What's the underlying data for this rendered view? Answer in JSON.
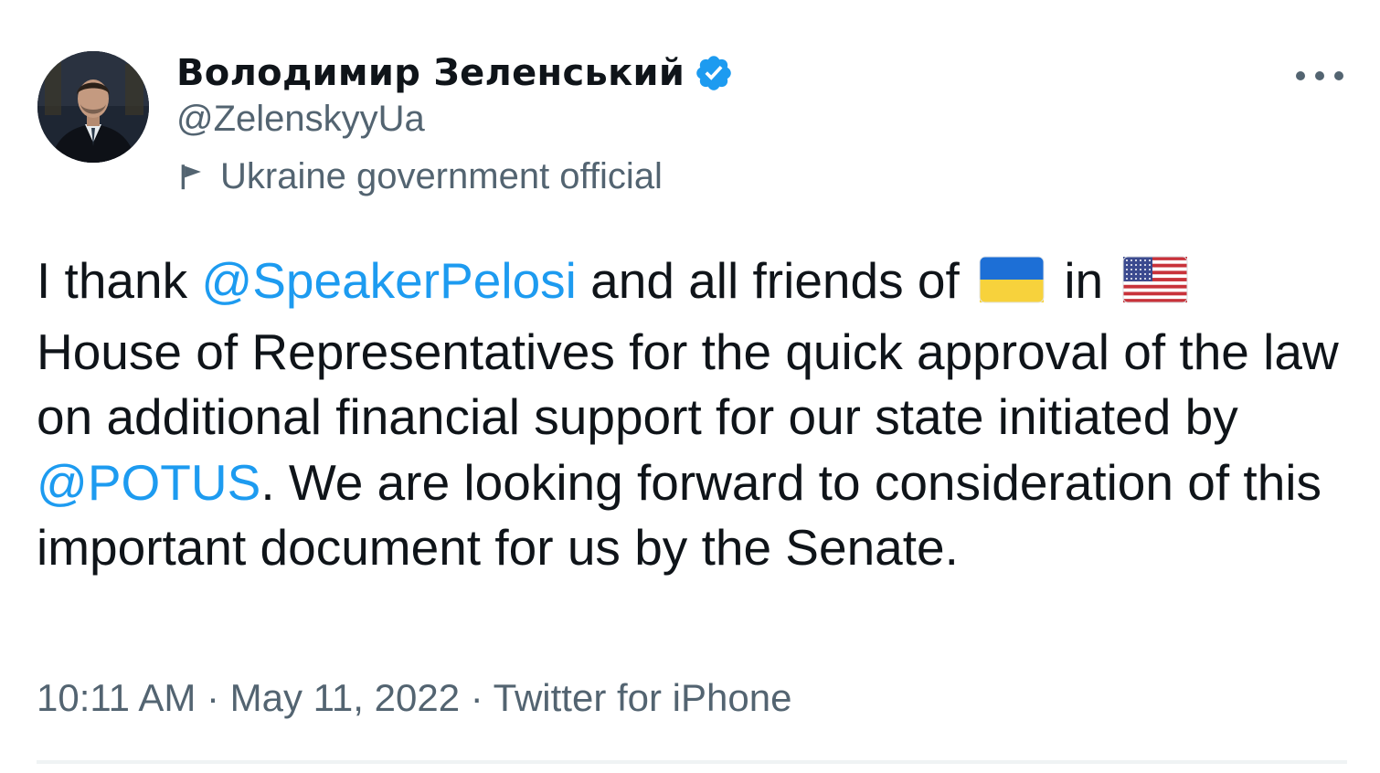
{
  "author": {
    "display_name": "Володимир Зеленський",
    "handle": "@ZelenskyyUa",
    "label": "Ukraine government official",
    "verified_icon": "verified-badge-icon",
    "label_icon": "flag-icon"
  },
  "tweet": {
    "segments": [
      {
        "type": "text",
        "value": "I thank "
      },
      {
        "type": "mention",
        "value": "@SpeakerPelosi"
      },
      {
        "type": "text",
        "value": " and all friends of "
      },
      {
        "type": "emoji",
        "value": "flag-ukraine"
      },
      {
        "type": "text",
        "value": " in "
      },
      {
        "type": "emoji",
        "value": "flag-united-states"
      },
      {
        "type": "text",
        "value": " House of Representatives for the quick approval of the law on additional financial support for our state initiated by "
      },
      {
        "type": "mention",
        "value": "@POTUS"
      },
      {
        "type": "text",
        "value": ". We are looking forward to consideration of this important document for us by the Senate."
      }
    ]
  },
  "meta": {
    "time": "10:11 AM",
    "separator": " · ",
    "date": "May 11, 2022",
    "source": "Twitter for iPhone"
  },
  "colors": {
    "mention": "#1d9bf0",
    "secondary_text": "#536471",
    "primary_text": "#0f1419",
    "divider": "#eff3f4"
  }
}
